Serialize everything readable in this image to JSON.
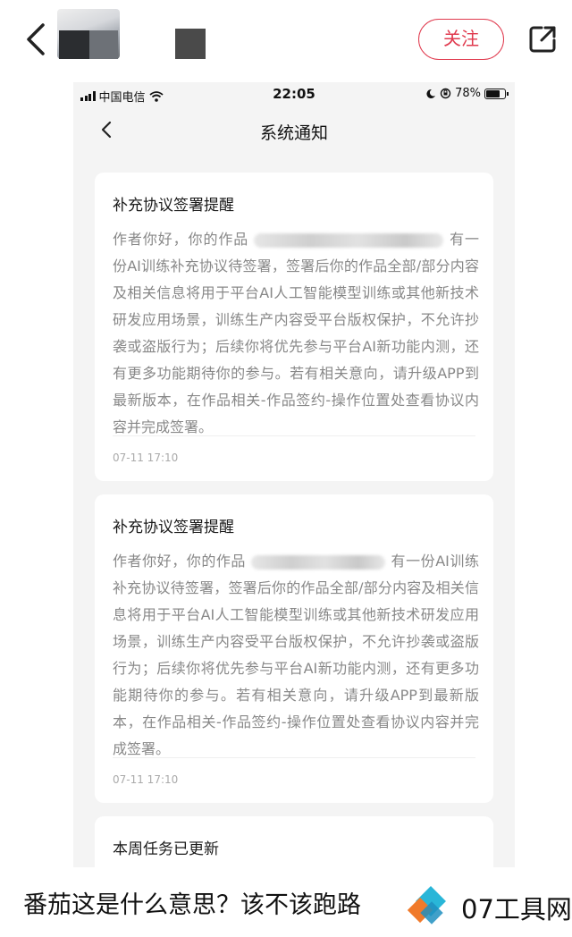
{
  "header": {
    "follow_label": "关注"
  },
  "phone": {
    "status_bar": {
      "carrier": "中国电信",
      "time": "22:05",
      "battery": "78%"
    },
    "nav": {
      "title": "系统通知"
    },
    "notifications": [
      {
        "title": "补充协议签署提醒",
        "body_pre": "作者你好，你的作品",
        "body_post": "有一份AI训练补充协议待签署，签署后你的作品全部/部分内容及相关信息将用于平台AI人工智能模型训练或其他新技术研发应用场景，训练生产内容受平台版权保护，不允许抄袭或盗版行为；后续你将优先参与平台AI新功能内测，还有更多功能期待你的参与。若有相关意向，请升级APP到最新版本，在作品相关-作品签约-操作位置处查看协议内容并完成签署。",
        "time": "07-11 17:10"
      },
      {
        "title": "补充协议签署提醒",
        "body_pre": "作者你好，你的作品",
        "body_post": "有一份AI训练补充协议待签署，签署后你的作品全部/部分内容及相关信息将用于平台AI人工智能模型训练或其他新技术研发应用场景，训练生产内容受平台版权保护，不允许抄袭或盗版行为；后续你将优先参与平台AI新功能内测，还有更多功能期待你的参与。若有相关意向，请升级APP到最新版本，在作品相关-作品签约-操作位置处查看协议内容并完成签署。",
        "time": "07-11 17:10"
      },
      {
        "title": "本周任务已更新"
      }
    ]
  },
  "caption": "番茄这是什么意思？该不该跑路",
  "watermark": "07工具网",
  "colors": {
    "accent": "#e03a4e",
    "body_text": "#888888",
    "page_bg": "#f4f4f4"
  },
  "icons": [
    "back-chevron-icon",
    "share-icon",
    "signal-icon",
    "wifi-icon",
    "moon-icon",
    "rotation-lock-icon",
    "battery-icon"
  ]
}
